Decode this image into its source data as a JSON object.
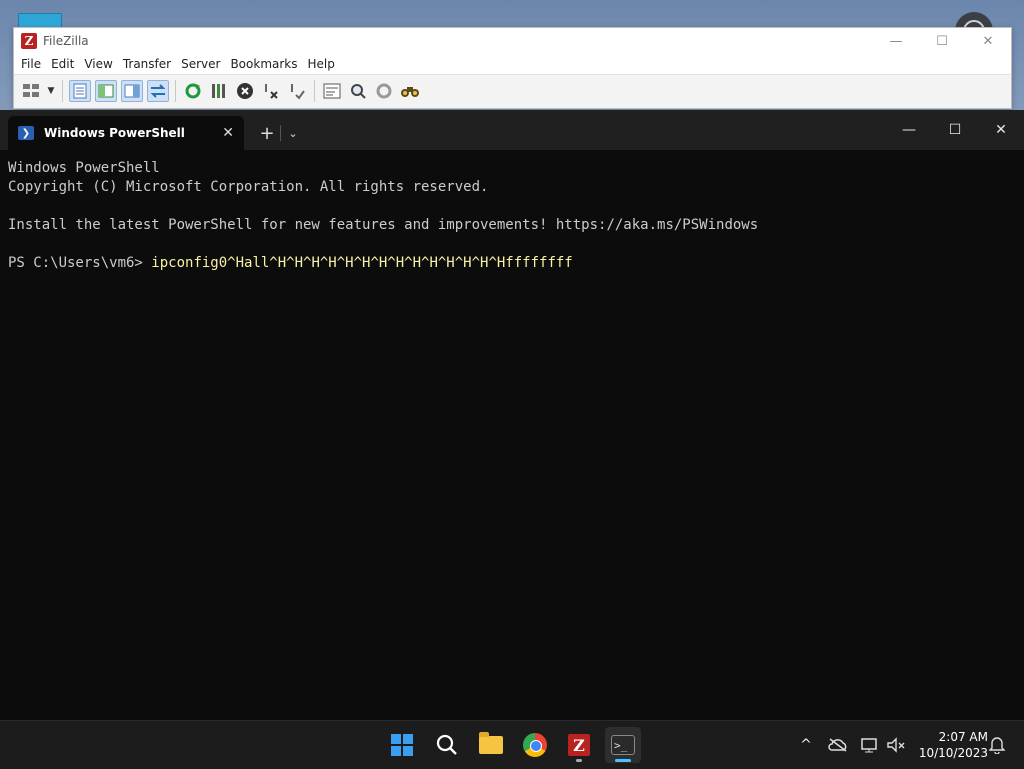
{
  "filezilla": {
    "title": "FileZilla",
    "logo_letter": "Z",
    "controls": {
      "minimize": "—",
      "maximize": "☐",
      "close": "✕"
    },
    "menu": [
      "File",
      "Edit",
      "View",
      "Transfer",
      "Server",
      "Bookmarks",
      "Help"
    ],
    "toolbar_icons": [
      "site-manager-icon",
      "dropdown-icon",
      "toggle-message-log-icon",
      "toggle-local-tree-icon",
      "toggle-remote-tree-icon",
      "toggle-transfer-queue-icon",
      "refresh-icon",
      "process-queue-icon",
      "cancel-icon",
      "disconnect-icon",
      "reconnect-icon",
      "directory-filter-icon",
      "compare-icon",
      "sync-browse-icon",
      "search-icon"
    ]
  },
  "terminal": {
    "tab_title": "Windows PowerShell",
    "tab_close": "✕",
    "new_tab": "+",
    "dropdown": "⌄",
    "controls": {
      "minimize": "—",
      "maximize": "☐",
      "close": "✕"
    },
    "lines": [
      "Windows PowerShell",
      "Copyright (C) Microsoft Corporation. All rights reserved.",
      "",
      "Install the latest PowerShell for new features and improvements! https://aka.ms/PSWindows",
      ""
    ],
    "prompt": "PS C:\\Users\\vm6> ",
    "command": "ipconfig0^Hall^H^H^H^H^H^H^H^H^H^H^H^H^H^Hffffffff"
  },
  "taskbar": {
    "apps": [
      "start-icon",
      "search-icon",
      "file-explorer-icon",
      "chrome-icon",
      "filezilla-icon",
      "terminal-icon"
    ],
    "tray": {
      "chevron": "^",
      "time": "2:07 AM",
      "date": "10/10/2023"
    }
  }
}
